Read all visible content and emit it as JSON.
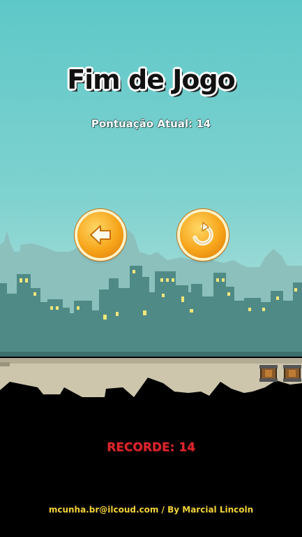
{
  "screen": {
    "title": "Fim de Jogo",
    "score_label": "Pontuação Atual: 14",
    "record_label": "RECORDE: 14",
    "credits_email": "mcunha.br@ilcoud.com",
    "credits_separator": " / ",
    "credits_author": "By Marcial Lincoln"
  },
  "buttons": {
    "back_icon": "arrow-left-icon",
    "restart_icon": "restart-icon"
  },
  "colors": {
    "sky_top": "#5ec8c8",
    "sky_bottom": "#b8e4e2",
    "city_front": "#4f8a86",
    "city_back": "#82b6b5",
    "window": "#f2e67a",
    "record_red": "#d9252b",
    "credits_yellow": "#f3d236",
    "button_orange": "#f7a51a"
  }
}
